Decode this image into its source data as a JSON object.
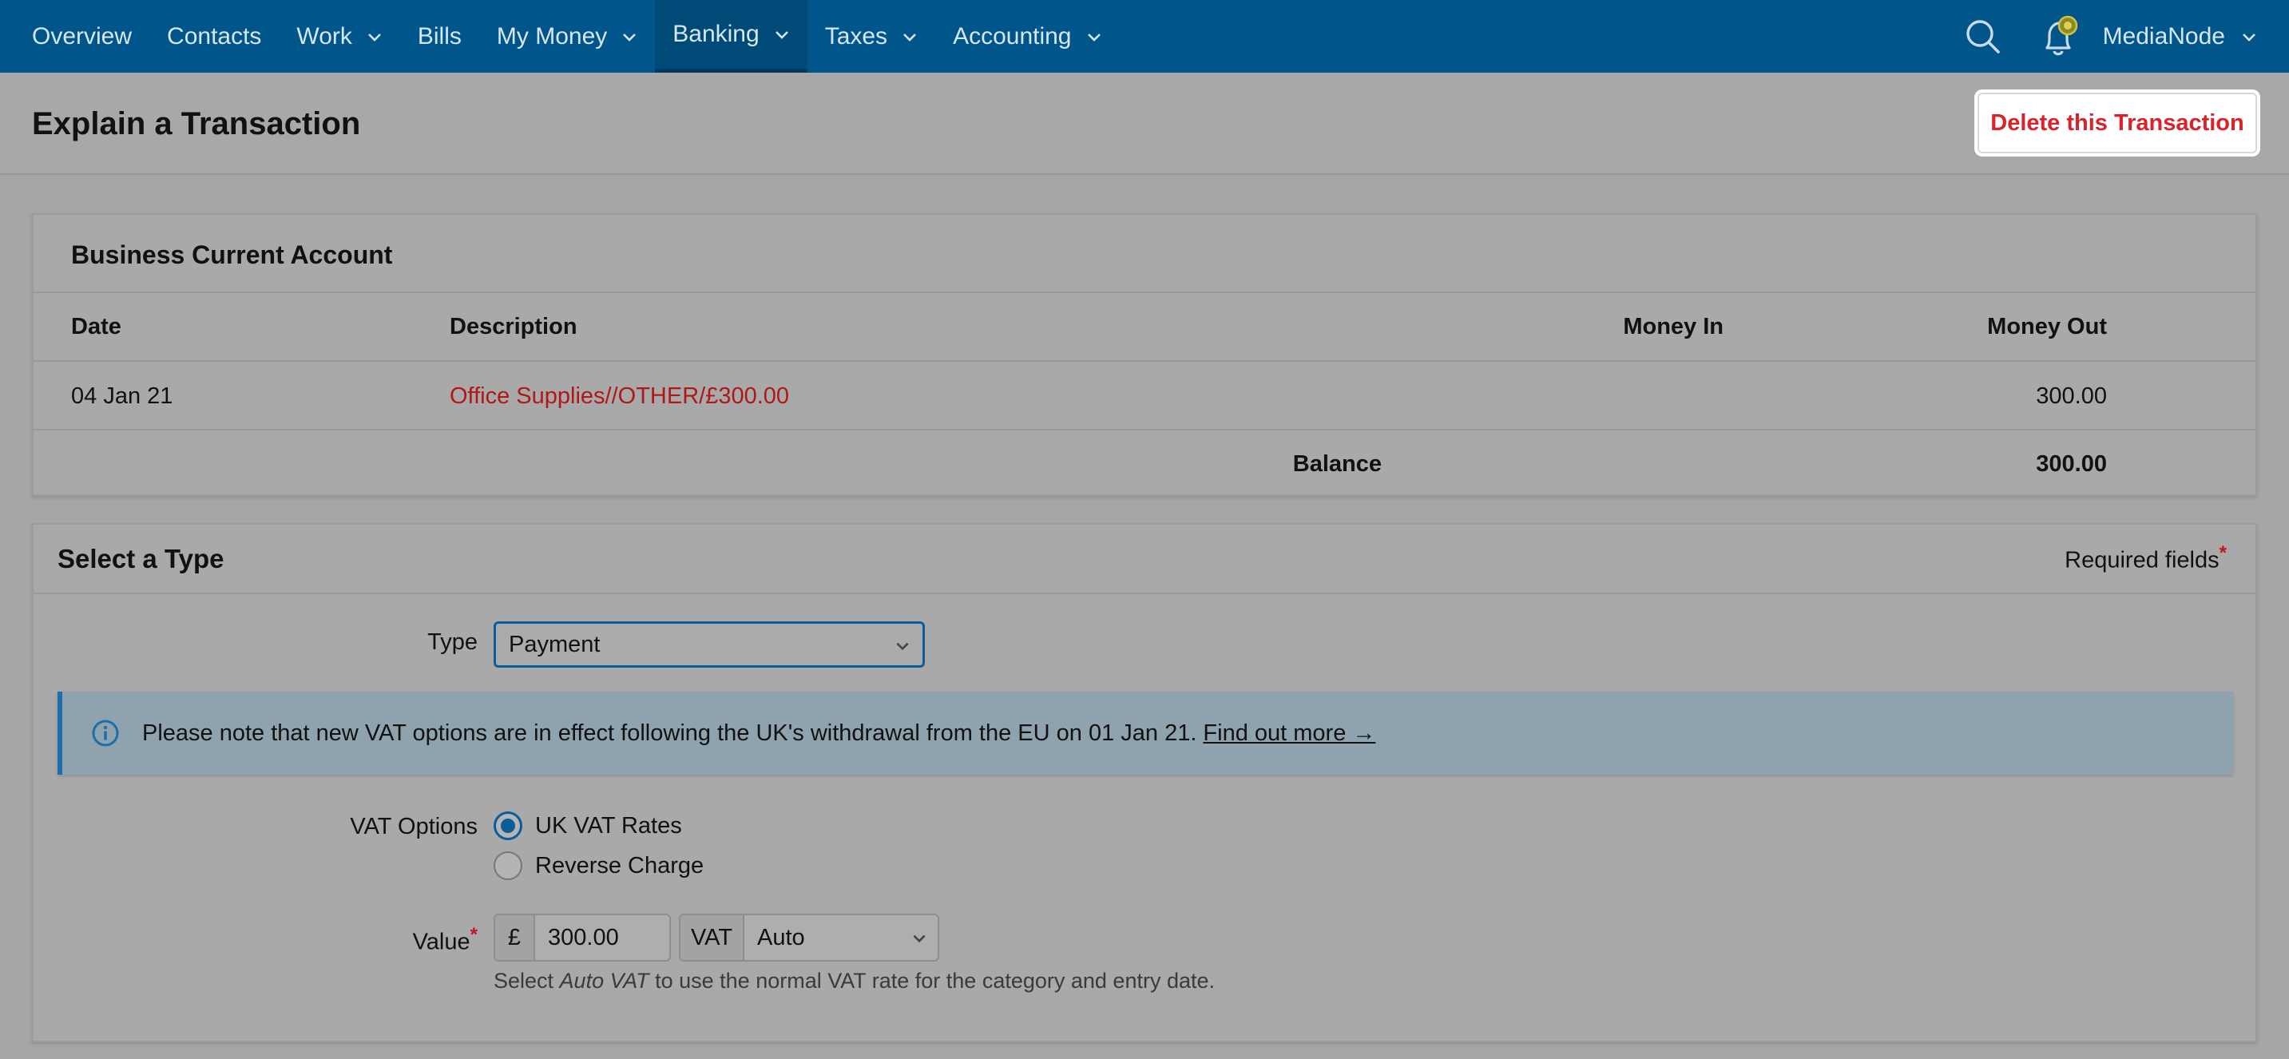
{
  "nav": {
    "items": [
      {
        "label": "Overview",
        "dropdown": false
      },
      {
        "label": "Contacts",
        "dropdown": false
      },
      {
        "label": "Work",
        "dropdown": true
      },
      {
        "label": "Bills",
        "dropdown": false
      },
      {
        "label": "My Money",
        "dropdown": true
      },
      {
        "label": "Banking",
        "dropdown": true,
        "active": true
      },
      {
        "label": "Taxes",
        "dropdown": true
      },
      {
        "label": "Accounting",
        "dropdown": true
      }
    ],
    "user": "MediaNode",
    "icons": {
      "search": "search-icon",
      "notifications": "bell-icon"
    }
  },
  "header": {
    "title": "Explain a Transaction",
    "delete_label": "Delete this Transaction"
  },
  "account": {
    "title": "Business Current Account",
    "columns": {
      "date": "Date",
      "description": "Description",
      "money_in": "Money In",
      "money_out": "Money Out"
    },
    "row": {
      "date": "04 Jan 21",
      "description": "Office Supplies//OTHER/£300.00",
      "money_in": "",
      "money_out": "300.00"
    },
    "balance_label": "Balance",
    "balance_value": "300.00"
  },
  "select_type": {
    "title": "Select a Type",
    "required_label": "Required fields",
    "required_star": "*",
    "type_label": "Type",
    "type_value": "Payment",
    "info_text": "Please note that new VAT options are in effect following the UK's withdrawal from the EU on 01 Jan 21.",
    "info_link": "Find out more →",
    "vat_label": "VAT Options",
    "vat_options": [
      "UK VAT Rates",
      "Reverse Charge"
    ],
    "vat_selected": "UK VAT Rates",
    "value_label": "Value",
    "currency": "£",
    "value": "300.00",
    "vat_addon": "VAT",
    "vat_mode": "Auto",
    "hint_pre": "Select ",
    "hint_em": "Auto VAT",
    "hint_post": " to use the normal VAT rate for the category and entry date."
  },
  "colors": {
    "nav_bg": "#00568a",
    "accent": "#0a5d99",
    "danger": "#d8232a",
    "link_red": "#b01818"
  }
}
